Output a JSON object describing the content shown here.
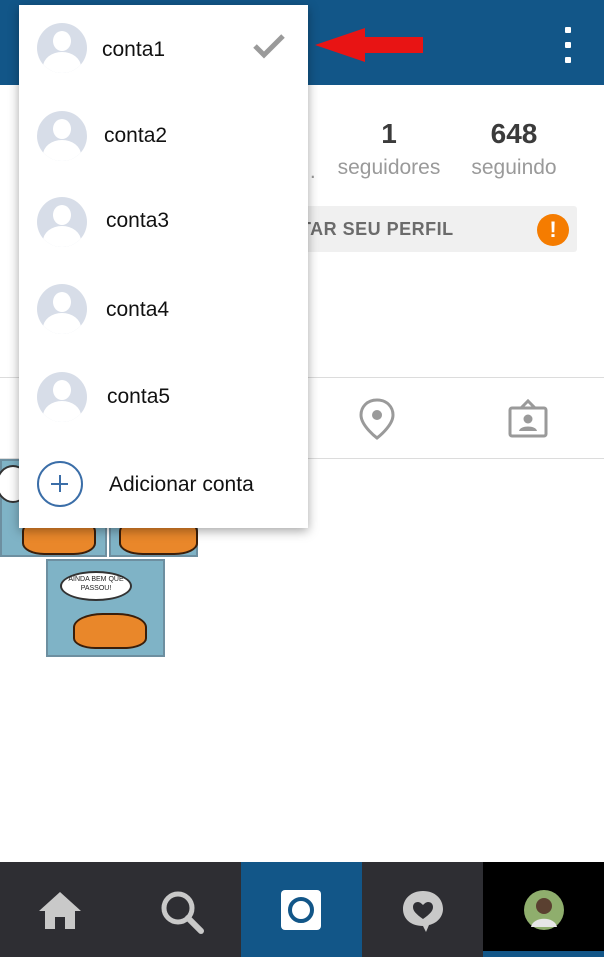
{
  "header": {
    "menu_icon": "more-vert-icon"
  },
  "profile": {
    "posts_truncated": "..",
    "followers": {
      "count": "1",
      "label": "seguidores"
    },
    "following": {
      "count": "648",
      "label": "seguindo"
    },
    "edit_profile_label": "TAR SEU PERFIL",
    "alert_symbol": "!"
  },
  "tabs": [
    "location-pin-icon",
    "tagged-photos-icon"
  ],
  "posts": [
    {
      "bubble": "AINDA BEM QUE PASSOU!"
    }
  ],
  "account_menu": {
    "accounts": [
      {
        "name": "conta1",
        "selected": true
      },
      {
        "name": "conta2",
        "selected": false
      },
      {
        "name": "conta3",
        "selected": false
      },
      {
        "name": "conta4",
        "selected": false
      },
      {
        "name": "conta5",
        "selected": false
      }
    ],
    "add_account_label": "Adicionar conta"
  },
  "bottom_nav": {
    "items": [
      "home-icon",
      "search-icon",
      "camera-icon",
      "activity-heart-icon",
      "profile-avatar"
    ],
    "active_index": 2
  },
  "colors": {
    "brand": "#125688",
    "nav_bg": "#2e2e33",
    "alert": "#f57c00",
    "arrow": "#e81414"
  }
}
